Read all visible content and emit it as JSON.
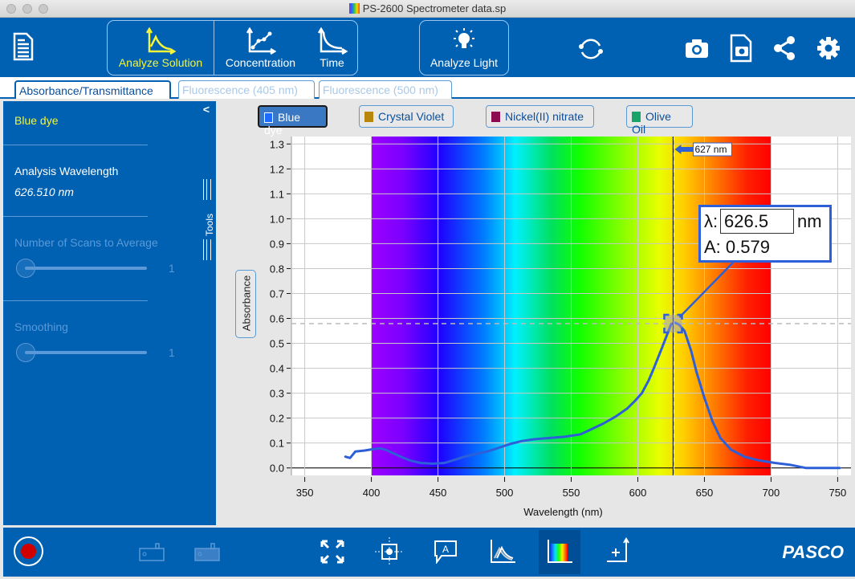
{
  "window": {
    "title": "PS-2600 Spectrometer data.sp"
  },
  "toolbar": {
    "file_icon": "file-icon",
    "modes": [
      {
        "label": "Analyze Solution",
        "icon": "absorbance-peak-icon",
        "active": true
      },
      {
        "label": "Concentration",
        "icon": "concentration-graph-icon",
        "active": false
      },
      {
        "label": "Time",
        "icon": "time-decay-icon",
        "active": false
      },
      {
        "label": "Analyze Light",
        "icon": "lightbulb-icon",
        "active": false
      }
    ],
    "right_icons": [
      "sync-icon",
      "camera-icon",
      "snapshot-file-icon",
      "share-icon",
      "gear-icon"
    ],
    "active_color": "#f5f53c"
  },
  "tabs": [
    {
      "label": "Absorbance/Transmittance",
      "active": true
    },
    {
      "label": "Fluorescence (405 nm)",
      "active": false
    },
    {
      "label": "Fluorescence (500 nm)",
      "active": false
    }
  ],
  "sidebar": {
    "sample_name": "Blue dye",
    "analysis_wavelength_label": "Analysis Wavelength",
    "analysis_wavelength_value": "626.510 nm",
    "scans_label": "Number of Scans to Average",
    "scans_value": "1",
    "smoothing_label": "Smoothing",
    "smoothing_value": "1",
    "tools_label": "Tools",
    "collapse_glyph": "<"
  },
  "legend": [
    {
      "label": "Blue dye",
      "color": "#1e6cff",
      "active": true
    },
    {
      "label": "Crystal Violet",
      "color": "#b8860b",
      "active": false
    },
    {
      "label": "Nickel(II) nitrate",
      "color": "#8b0a50",
      "active": false
    },
    {
      "label": "Olive Oil",
      "color": "#1aa36b",
      "active": false
    }
  ],
  "cursor": {
    "flag_label": "627 nm",
    "lambda_prefix": "λ:",
    "lambda_value": "626.5",
    "lambda_unit": "nm",
    "absorbance_text": "A: 0.579"
  },
  "chart_data": {
    "type": "line",
    "title": "",
    "xlabel": "Wavelength (nm)",
    "ylabel": "Absorbance",
    "xlim": [
      340,
      760
    ],
    "ylim": [
      -0.03,
      1.33
    ],
    "x_ticks": [
      350,
      400,
      450,
      500,
      550,
      600,
      650,
      700,
      750
    ],
    "y_ticks": [
      0.0,
      0.1,
      0.2,
      0.3,
      0.4,
      0.5,
      0.6,
      0.7,
      0.8,
      0.9,
      1.0,
      1.1,
      1.2,
      1.3
    ],
    "grid": true,
    "spectrum_band_nm": [
      400,
      700
    ],
    "cursor_wavelength": 626.5,
    "cursor_absorbance": 0.579,
    "series": [
      {
        "name": "Blue dye",
        "color": "#2d5fd8",
        "x": [
          380,
          384,
          388,
          395,
          402,
          407,
          412,
          420,
          429,
          437,
          446,
          455,
          461,
          470,
          480,
          487,
          495,
          504,
          513,
          522,
          533,
          545,
          557,
          565,
          574,
          583,
          592,
          598,
          603,
          608,
          612,
          618,
          625,
          628,
          631,
          635,
          640,
          644,
          650,
          656,
          662,
          670,
          680,
          691,
          703,
          714,
          726,
          740,
          752
        ],
        "y": [
          0.046,
          0.04,
          0.066,
          0.07,
          0.076,
          0.079,
          0.07,
          0.05,
          0.03,
          0.02,
          0.017,
          0.02,
          0.03,
          0.045,
          0.058,
          0.066,
          0.08,
          0.096,
          0.108,
          0.115,
          0.12,
          0.125,
          0.135,
          0.155,
          0.178,
          0.205,
          0.238,
          0.27,
          0.3,
          0.35,
          0.4,
          0.48,
          0.577,
          0.583,
          0.575,
          0.55,
          0.47,
          0.386,
          0.28,
          0.188,
          0.12,
          0.073,
          0.045,
          0.03,
          0.02,
          0.013,
          0.0,
          0.0,
          0.0
        ]
      }
    ]
  },
  "bottombar": {
    "left_icons": [
      "record-icon",
      "sensor-device-icon",
      "sensor-device-2-icon"
    ],
    "center_icons": [
      "expand-icon",
      "crosshair-icon",
      "annotation-icon",
      "multi-peak-icon",
      "spectrum-icon",
      "add-axis-icon"
    ],
    "brand": "PASCO"
  }
}
